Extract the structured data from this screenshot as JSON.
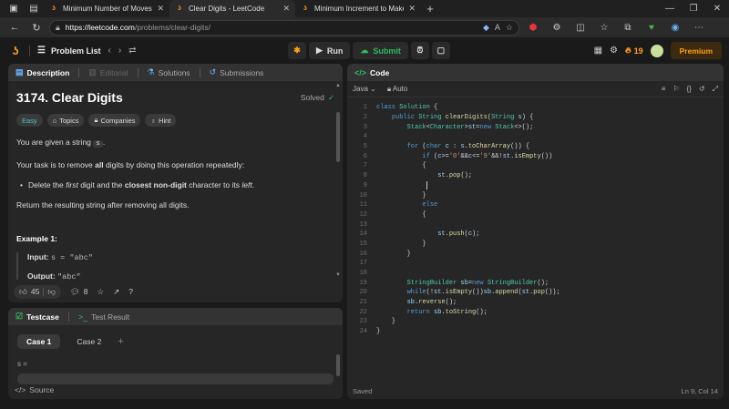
{
  "browser": {
    "tabs": [
      {
        "title": "Minimum Number of Moves to S",
        "active": false,
        "icon_color": "#ffa116"
      },
      {
        "title": "Clear Digits - LeetCode",
        "active": true,
        "icon_color": "#ffa116"
      },
      {
        "title": "Minimum Increment to Make An",
        "active": false,
        "icon_color": "#ffa116"
      }
    ],
    "url_host": "https://leetcode.com",
    "url_path": "/problems/clear-digits/"
  },
  "topbar": {
    "problem_list": "Problem List",
    "run": "Run",
    "submit": "Submit",
    "streak": "19",
    "premium": "Premium"
  },
  "description": {
    "tabs": [
      "Description",
      "Editorial",
      "Solutions",
      "Submissions"
    ],
    "title": "3174. Clear Digits",
    "solved": "Solved",
    "tags": [
      "Easy",
      "Topics",
      "Companies",
      "Hint"
    ],
    "intro_a": "You are given a string",
    "intro_code": "s",
    "intro_b": ".",
    "task_a": "Your task is to remove",
    "task_b": "all",
    "task_c": "digits by doing this operation repeatedly:",
    "bullet_a": "Delete the",
    "bullet_b": "first",
    "bullet_c": "digit and the",
    "bullet_d": "closest non-digit",
    "bullet_e": "character to its",
    "bullet_f": "left",
    "bullet_g": ".",
    "result": "Return the resulting string after removing all digits.",
    "example_title": "Example 1:",
    "input_label": "Input:",
    "input_value": "s = \"abc\"",
    "output_label": "Output:",
    "output_value": "\"abc\"",
    "likes": "45",
    "comments": "8"
  },
  "testpanel": {
    "tab_testcase": "Testcase",
    "tab_result": "Test Result",
    "cases": [
      "Case 1",
      "Case 2"
    ],
    "input_label": "s =",
    "source": "Source"
  },
  "editor": {
    "title": "Code",
    "language": "Java",
    "mode": "Auto",
    "status": "Saved",
    "position": "Ln 9, Col 14"
  }
}
